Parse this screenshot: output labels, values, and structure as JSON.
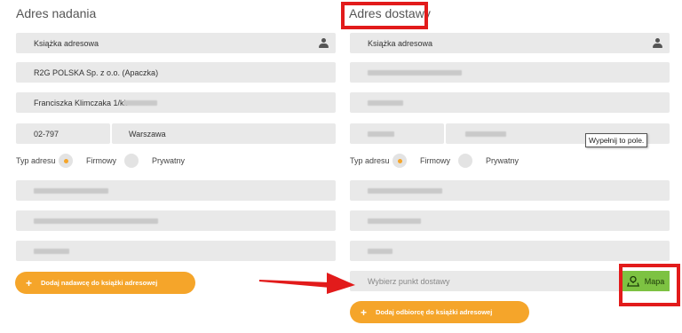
{
  "sender": {
    "heading": "Adres nadania",
    "address_book": "Książka adresowa",
    "company": "R2G POLSKA Sp. z o.o. (Apaczka)",
    "street": "Franciszka Klimczaka 1/kl.",
    "postcode": "02-797",
    "city": "Warszawa",
    "type_label": "Typ adresu",
    "type_company": "Firmowy",
    "type_private": "Prywatny",
    "add_button": "Dodaj nadawcę do książki adresowej",
    "add_icon": "+"
  },
  "recipient": {
    "heading": "Adres dostawy",
    "address_book": "Książka adresowa",
    "type_label": "Typ adresu",
    "type_company": "Firmowy",
    "type_private": "Prywatny",
    "pickup_placeholder": "Wybierz punkt dostawy",
    "map_button": "Mapa",
    "add_button": "Dodaj odbiorcę do książki adresowej",
    "add_icon": "+"
  },
  "tooltip": "Wypełnij to pole.",
  "colors": {
    "accent": "#f5a52a",
    "map_green": "#7dc242",
    "highlight_red": "#e21b1b",
    "field_bg": "#e9e9e9"
  },
  "icons": [
    "person-icon",
    "map-pin-icon",
    "arrow-icon"
  ]
}
